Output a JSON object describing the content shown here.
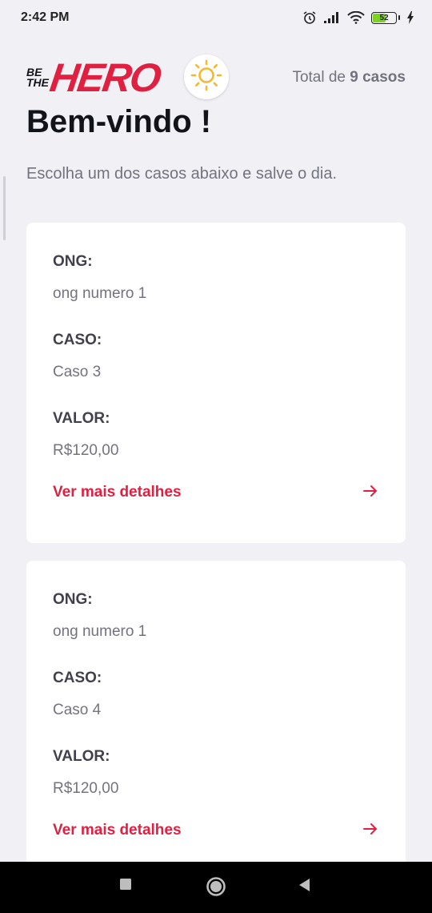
{
  "status_bar": {
    "time": "2:42 PM",
    "battery_level": "52"
  },
  "header": {
    "logo_small_1": "BE",
    "logo_small_2": "THE",
    "logo_main": "HERO",
    "total_prefix": "Total de",
    "total_count": "9 casos"
  },
  "title": "Bem-vindo !",
  "subtitle": "Escolha um dos casos abaixo e salve o dia.",
  "labels": {
    "ong": "ONG:",
    "caso": "CASO:",
    "valor": "VALOR:",
    "details": "Ver mais detalhes"
  },
  "incidents": [
    {
      "ong": "ong numero 1",
      "caso": "Caso 3",
      "valor": "R$120,00"
    },
    {
      "ong": "ong numero 1",
      "caso": "Caso 4",
      "valor": "R$120,00"
    }
  ],
  "colors": {
    "accent": "#e02041",
    "background": "#f0f0f5",
    "sun": "#f5b82e"
  }
}
